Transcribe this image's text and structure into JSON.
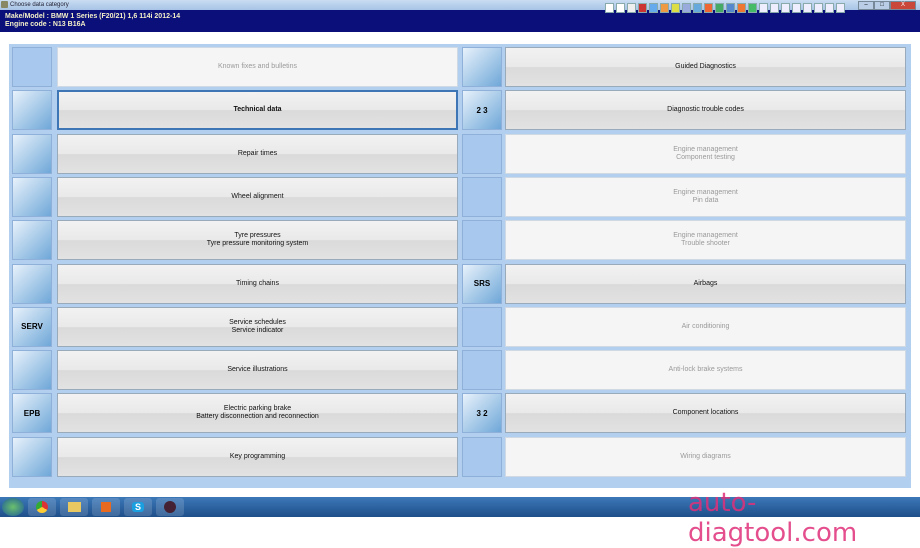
{
  "window": {
    "title": "Choose data category"
  },
  "header": {
    "make_label": "Make/Model",
    "make_value": ": BMW   1 Series (F20/21) 1,6 114i 2012-14",
    "engine_label": "Engine code",
    "engine_value": ": N13 B16A"
  },
  "rows": [
    {
      "left": {
        "icon": "bulletin-icon",
        "lines": [
          "Known fixes and bulletins"
        ],
        "enabled": false,
        "has_icon": false
      },
      "right": {
        "icon": "diagnostic-device-icon",
        "lines": [
          "Guided Diagnostics"
        ],
        "enabled": true,
        "has_icon": true
      }
    },
    {
      "left": {
        "icon": "wrench-icon",
        "lines": [
          "Technical data"
        ],
        "enabled": true,
        "selected": true,
        "has_icon": true
      },
      "right": {
        "icon": "trouble-codes-icon",
        "lines": [
          "Diagnostic trouble codes"
        ],
        "enabled": true,
        "has_icon": true,
        "badge": "2 3"
      }
    },
    {
      "left": {
        "icon": "stopwatch-icon",
        "lines": [
          "Repair times"
        ],
        "enabled": true,
        "has_icon": true
      },
      "right": {
        "icon": "",
        "lines": [
          "Engine management",
          "Component testing"
        ],
        "enabled": false,
        "has_icon": false
      }
    },
    {
      "left": {
        "icon": "wheel-alignment-icon",
        "lines": [
          "Wheel alignment"
        ],
        "enabled": true,
        "has_icon": true
      },
      "right": {
        "icon": "",
        "lines": [
          "Engine management",
          "Pin data"
        ],
        "enabled": false,
        "has_icon": false
      }
    },
    {
      "left": {
        "icon": "tyre-pressure-icon",
        "lines": [
          "Tyre pressures",
          "Tyre pressure monitoring system"
        ],
        "enabled": true,
        "has_icon": true
      },
      "right": {
        "icon": "",
        "lines": [
          "Engine management",
          "Trouble shooter"
        ],
        "enabled": false,
        "has_icon": false
      }
    },
    {
      "left": {
        "icon": "timing-chain-icon",
        "lines": [
          "Timing chains"
        ],
        "enabled": true,
        "has_icon": true
      },
      "right": {
        "icon": "airbag-icon",
        "lines": [
          "Airbags"
        ],
        "enabled": true,
        "has_icon": true,
        "badge": "SRS"
      }
    },
    {
      "left": {
        "icon": "service-icon",
        "lines": [
          "Service schedules",
          "Service indicator"
        ],
        "enabled": true,
        "has_icon": true,
        "badge": "SERV"
      },
      "right": {
        "icon": "",
        "lines": [
          "Air conditioning"
        ],
        "enabled": false,
        "has_icon": false
      }
    },
    {
      "left": {
        "icon": "lift-icon",
        "lines": [
          "Service illustrations"
        ],
        "enabled": true,
        "has_icon": true
      },
      "right": {
        "icon": "",
        "lines": [
          "Anti-lock brake systems"
        ],
        "enabled": false,
        "has_icon": false
      }
    },
    {
      "left": {
        "icon": "parking-brake-icon",
        "lines": [
          "Electric parking brake",
          "Battery disconnection and reconnection"
        ],
        "enabled": true,
        "has_icon": true,
        "badge": "EPB"
      },
      "right": {
        "icon": "component-location-icon",
        "lines": [
          "Component locations"
        ],
        "enabled": true,
        "has_icon": true,
        "badge": "3 2"
      }
    },
    {
      "left": {
        "icon": "key-icon",
        "lines": [
          "Key programming"
        ],
        "enabled": true,
        "has_icon": true
      },
      "right": {
        "icon": "",
        "lines": [
          "Wiring diagrams"
        ],
        "enabled": false,
        "has_icon": false
      }
    }
  ],
  "window_buttons": {
    "minimize": "–",
    "maximize": "□",
    "close": "X"
  },
  "taskbar": {
    "apps": [
      "start",
      "chrome",
      "explorer",
      "media-player",
      "skype",
      "autodata"
    ],
    "skype_label": "S"
  },
  "watermark": "auto-diagtool.com"
}
